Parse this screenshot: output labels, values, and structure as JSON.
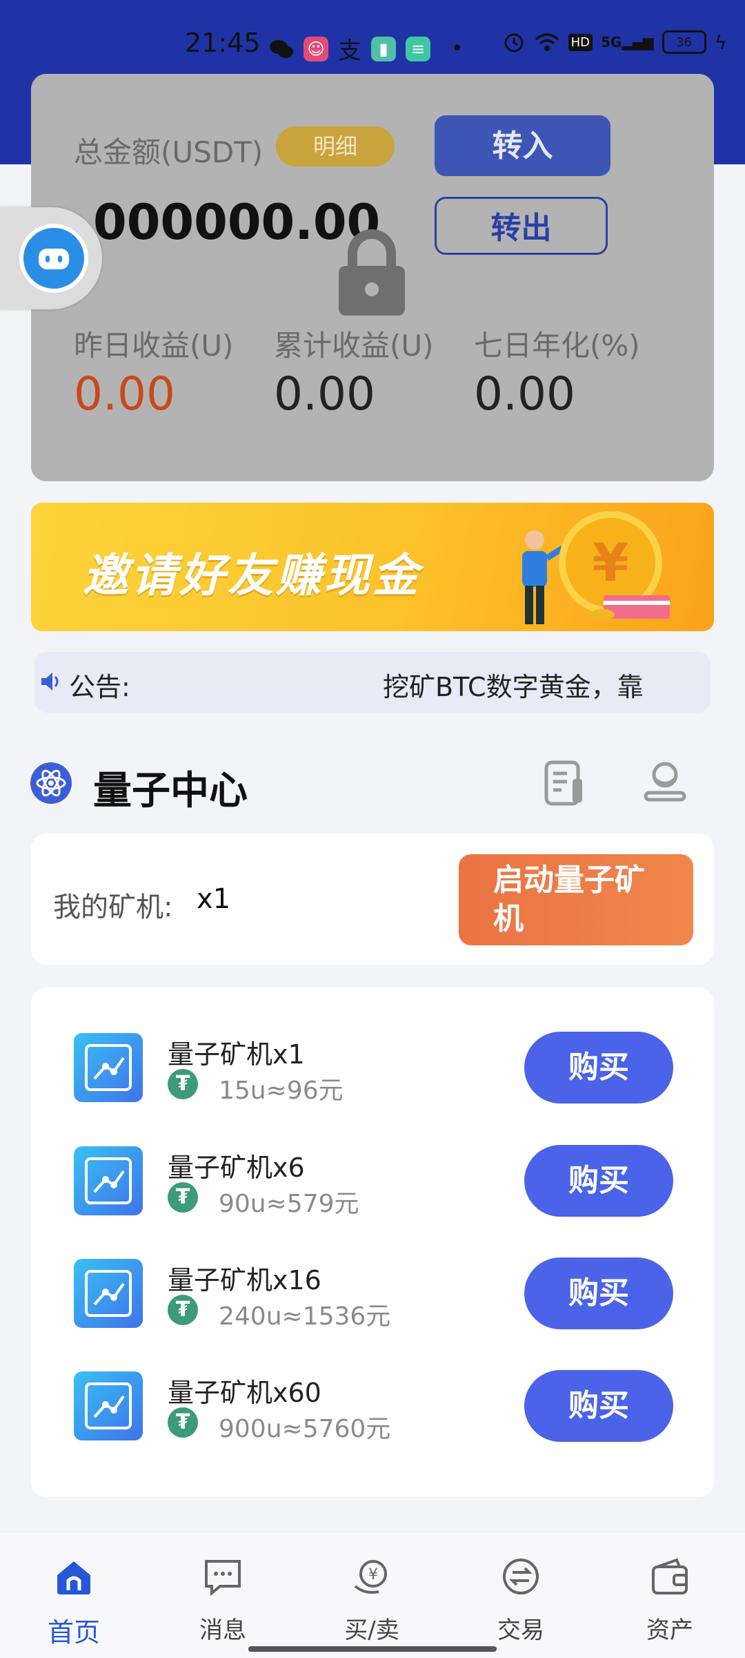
{
  "status_bar": {
    "time": "21:45",
    "battery": "36",
    "network": "5G"
  },
  "account": {
    "total_label": "总金额(USDT)",
    "detail_badge": "明细",
    "transfer_in": "转入",
    "transfer_out": "转出",
    "total_amount": "000000.00",
    "stats": [
      {
        "label": "昨日收益(U)",
        "value": "0.00"
      },
      {
        "label": "累计收益(U)",
        "value": "0.00"
      },
      {
        "label": "七日年化(%)",
        "value": "0.00"
      }
    ]
  },
  "banner": {
    "text": "邀请好友赚现金",
    "coin_symbol": "¥"
  },
  "notice": {
    "label": "公告:",
    "text": "挖矿BTC数字黄金，靠"
  },
  "section": {
    "title": "量子中心"
  },
  "my_miner": {
    "label": "我的矿机:",
    "count": "x1",
    "start_button": "启动量子矿机"
  },
  "products": [
    {
      "name": "量子矿机x1",
      "price": "15u≈96元",
      "button": "购买"
    },
    {
      "name": "量子矿机x6",
      "price": "90u≈579元",
      "button": "购买"
    },
    {
      "name": "量子矿机x16",
      "price": "240u≈1536元",
      "button": "购买"
    },
    {
      "name": "量子矿机x60",
      "price": "900u≈5760元",
      "button": "购买"
    }
  ],
  "nav": [
    {
      "label": "首页",
      "icon": "home-icon",
      "active": true
    },
    {
      "label": "消息",
      "icon": "message-icon"
    },
    {
      "label": "买/卖",
      "icon": "buy-sell-icon"
    },
    {
      "label": "交易",
      "icon": "exchange-icon"
    },
    {
      "label": "资产",
      "icon": "wallet-icon"
    }
  ],
  "colors": {
    "primary": "#4a63e8",
    "header": "#1f33a6",
    "accent_orange": "#ea7343",
    "tether_green": "#3e9b78",
    "red_value": "#c8491b"
  }
}
